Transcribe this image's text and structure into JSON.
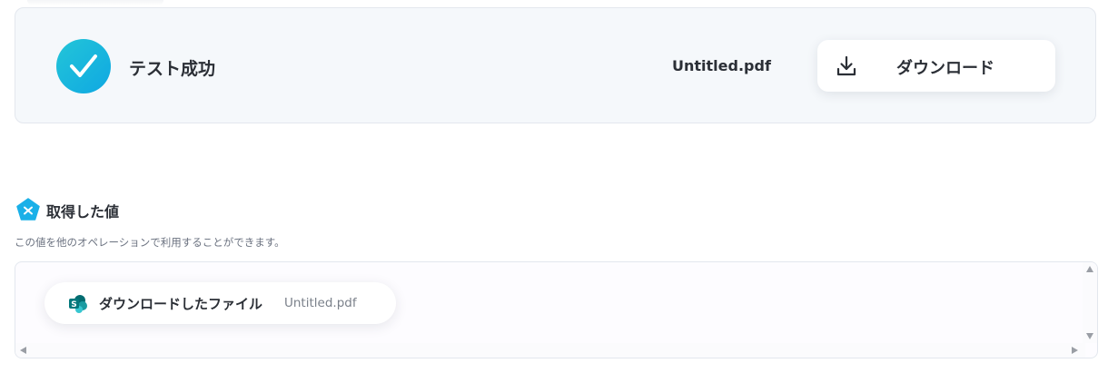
{
  "test_result": {
    "status_label": "テスト成功",
    "status_icon": "check-circle-icon",
    "file_name": "Untitled.pdf",
    "download_label": "ダウンロード",
    "download_icon": "download-icon"
  },
  "obtained_values": {
    "title": "取得した値",
    "title_icon": "variable-pentagon-icon",
    "description": "この値を他のオペレーションで利用することができます。",
    "items": [
      {
        "icon": "sharepoint-icon",
        "label": "ダウンロードしたファイル",
        "value": "Untitled.pdf"
      }
    ]
  },
  "colors": {
    "success_gradient_start": "#23c5d8",
    "success_gradient_end": "#0fa8e2",
    "section_icon": "#1ab0e8",
    "card_background": "#f5f8fb",
    "text_primary": "#2b2f36",
    "text_secondary": "#6b7280"
  }
}
